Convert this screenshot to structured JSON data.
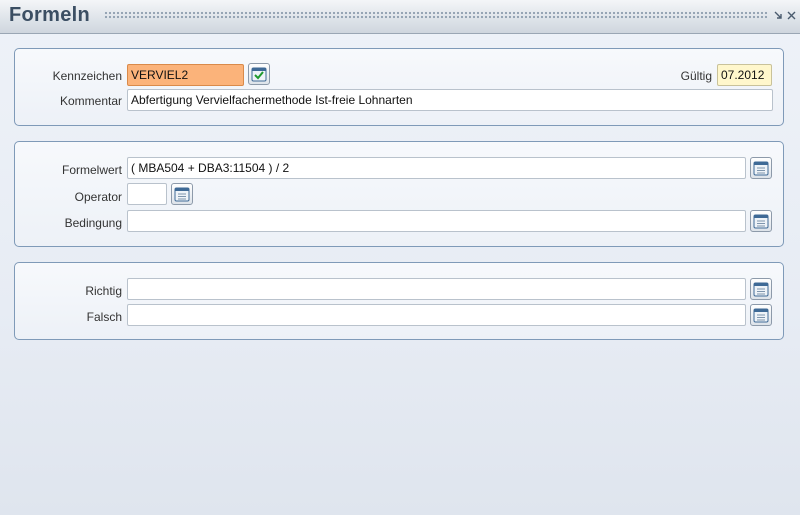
{
  "window": {
    "title": "Formeln",
    "min_icon": "minimize-icon",
    "close_icon": "close-icon"
  },
  "panel1": {
    "kennzeichen_label": "Kennzeichen",
    "kennzeichen_value": "VERVIEL2",
    "gueltig_label": "Gültig",
    "gueltig_value": "07.2012",
    "kommentar_label": "Kommentar",
    "kommentar_value": "Abfertigung Vervielfachermethode Ist-freie Lohnarten"
  },
  "panel2": {
    "formelwert_label": "Formelwert",
    "formelwert_value": "( MBA504 + DBA3:11504 ) / 2",
    "operator_label": "Operator",
    "operator_value": "",
    "bedingung_label": "Bedingung",
    "bedingung_value": ""
  },
  "panel3": {
    "richtig_label": "Richtig",
    "richtig_value": "",
    "falsch_label": "Falsch",
    "falsch_value": ""
  },
  "colors": {
    "highlight_field": "#fbb37a",
    "date_field": "#fff7cc",
    "title_text": "#3b4e63",
    "panel_border": "#7f9ab8"
  }
}
